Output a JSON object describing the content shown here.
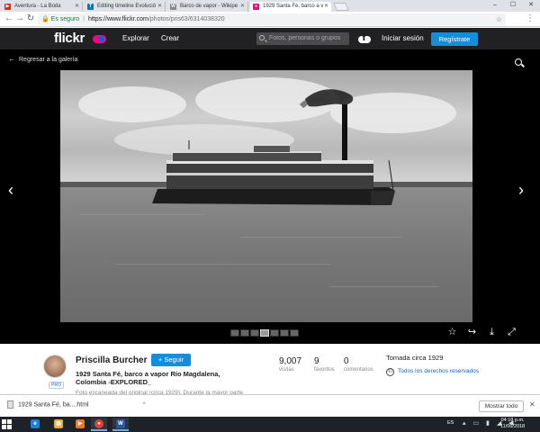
{
  "browser": {
    "tabs": [
      {
        "label": "Aventura - La Boda",
        "favicon": "youtube-icon",
        "color": "#e62117",
        "glyph": "▶"
      },
      {
        "label": "Editing timeline Evolució",
        "favicon": "trello-icon",
        "color": "#0079bf",
        "glyph": "T"
      },
      {
        "label": "Barco de vapor - Wikipe",
        "favicon": "wikipedia-icon",
        "color": "#888888",
        "glyph": "W"
      },
      {
        "label": "1929 Santa Fé, barco a v",
        "favicon": "flickr-icon",
        "color": "#ff0084",
        "glyph": "●"
      }
    ],
    "address": {
      "secure_label": "Es seguro",
      "url_host": "https://www.flickr.com",
      "url_path": "/photos/pris63/6314038320"
    }
  },
  "flickr_nav": {
    "logo": "flickr",
    "explore": "Explorar",
    "create": "Crear",
    "search_placeholder": "Fotos, personas o grupos",
    "login": "Iniciar sesión",
    "register": "Regístrate"
  },
  "lightbox": {
    "back_label": "Regresar a la galería",
    "thumbnail_count": 7,
    "current_thumbnail": 4
  },
  "photo_info": {
    "owner": "Priscilla Burcher",
    "pro_badge": "PRO",
    "follow": "+ Seguir",
    "title": "1929 Santa Fé, barco a vapor Río Magdalena, Colombia -EXPLORED_",
    "description": "Foto escaneada del original (circa 1929). Durante la mayor parte",
    "stats": [
      {
        "value": "9,007",
        "label": "visitas"
      },
      {
        "value": "9",
        "label": "favoritos"
      },
      {
        "value": "0",
        "label": "comentarios"
      }
    ],
    "taken": "Tomada circa 1929",
    "rights": "Todos los derechos reservados",
    "rights_symbol": "©"
  },
  "downloads": {
    "file": "1929 Santa Fé, ba....html",
    "show_all": "Mostrar todo"
  },
  "taskbar": {
    "language": "ES",
    "time": "04:18 p.m.",
    "date": "11/06/2018"
  }
}
